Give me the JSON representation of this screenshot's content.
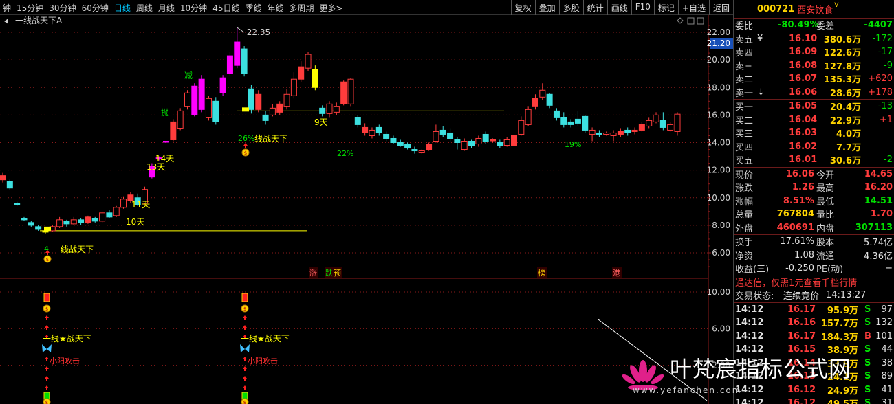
{
  "toolbar": {
    "periods": [
      "钟",
      "15分钟",
      "30分钟",
      "60分钟",
      "日线",
      "周线",
      "月线",
      "10分钟",
      "45日线",
      "季线",
      "年线",
      "多周期",
      "更多>"
    ],
    "active_period": "日线",
    "tools": [
      "复权",
      "叠加",
      "多股",
      "统计",
      "画线",
      "F10",
      "标记",
      "+自选",
      "返回"
    ]
  },
  "chart": {
    "indicator_title": "一线战天下A",
    "price_axis": [
      "22.00",
      "20.00",
      "18.00",
      "16.00",
      "14.00",
      "12.00",
      "10.00",
      "8.00",
      "6.00"
    ],
    "current_price_tag": "21.20",
    "sub_axis": [
      "10.00",
      "6.00",
      "2.00"
    ],
    "high_label": "22.35",
    "annotations": {
      "jian": "减",
      "pao": "抛",
      "t14": "14天",
      "t13": "13天",
      "t11": "11天",
      "t10": "10天",
      "t9": "9天",
      "pct26": "26%",
      "pct22": "22%",
      "pct19": "19%",
      "pct4": "4",
      "yxztx1": "一线战天下",
      "yxztx2": "线战天下"
    },
    "markers": {
      "zhang": "涨",
      "die": "跌",
      "yu": "预",
      "bang": "榜",
      "gang": "港"
    },
    "sub_labels": {
      "star1": "一线★战天下",
      "star2": "一线★战天下",
      "attack1": "小阳攻击",
      "attack2": "小阳攻击"
    },
    "colors": {
      "up": "#ff3c3c",
      "down": "#3ce0e0",
      "magenta": "#ff00ff",
      "yellow": "#ffff00",
      "grid": "#8a1a1a"
    }
  },
  "chart_data": {
    "type": "candlestick",
    "ylim": [
      5,
      23
    ],
    "candles": [
      {
        "o": 11.3,
        "c": 11.6,
        "h": 11.8,
        "l": 11.1
      },
      {
        "o": 11.2,
        "c": 10.7,
        "h": 11.3,
        "l": 10.6
      },
      {
        "o": 9.6,
        "c": 9.5,
        "h": 9.7,
        "l": 9.4
      },
      {
        "o": 8.5,
        "c": 8.4,
        "h": 8.6,
        "l": 8.3
      },
      {
        "o": 8.2,
        "c": 8.0,
        "h": 8.3,
        "l": 7.9
      },
      {
        "o": 7.9,
        "c": 7.7,
        "h": 8.0,
        "l": 7.6
      },
      {
        "o": 7.5,
        "c": 7.6,
        "h": 7.8,
        "l": 7.4
      },
      {
        "o": 7.6,
        "c": 7.9,
        "h": 8.0,
        "l": 7.5
      },
      {
        "o": 7.9,
        "c": 8.4,
        "h": 8.6,
        "l": 7.8
      },
      {
        "o": 8.3,
        "c": 8.1,
        "h": 8.4,
        "l": 7.9
      },
      {
        "o": 8.1,
        "c": 8.4,
        "h": 8.6,
        "l": 8.0
      },
      {
        "o": 8.4,
        "c": 8.2,
        "h": 8.5,
        "l": 8.0
      },
      {
        "o": 8.2,
        "c": 8.6,
        "h": 8.7,
        "l": 8.1
      },
      {
        "o": 8.5,
        "c": 8.3,
        "h": 8.6,
        "l": 8.2
      },
      {
        "o": 8.3,
        "c": 8.9,
        "h": 9.0,
        "l": 8.2
      },
      {
        "o": 8.9,
        "c": 8.6,
        "h": 9.1,
        "l": 8.5
      },
      {
        "o": 8.7,
        "c": 9.3,
        "h": 9.4,
        "l": 8.6
      },
      {
        "o": 9.3,
        "c": 9.9,
        "h": 10.1,
        "l": 9.2
      },
      {
        "o": 9.8,
        "c": 10.2,
        "h": 10.4,
        "l": 9.6
      },
      {
        "o": 10.0,
        "c": 9.5,
        "h": 10.3,
        "l": 9.4
      },
      {
        "o": 9.6,
        "c": 10.6,
        "h": 10.8,
        "l": 9.5
      },
      {
        "o": 11.5,
        "c": 12.3,
        "h": 12.5,
        "l": 11.4
      },
      {
        "o": 12.8,
        "c": 12.9,
        "h": 13.0,
        "l": 12.7
      },
      {
        "o": 14.1,
        "c": 14.1,
        "h": 14.3,
        "l": 13.9
      },
      {
        "o": 14.2,
        "c": 15.5,
        "h": 15.7,
        "l": 14.1
      },
      {
        "o": 15.0,
        "c": 16.3,
        "h": 16.5,
        "l": 14.9
      },
      {
        "o": 16.6,
        "c": 17.6,
        "h": 17.8,
        "l": 16.4
      },
      {
        "o": 16.0,
        "c": 18.1,
        "h": 18.3,
        "l": 15.9
      },
      {
        "o": 18.6,
        "c": 16.4,
        "h": 18.9,
        "l": 16.2
      },
      {
        "o": 15.8,
        "c": 17.2,
        "h": 17.4,
        "l": 15.6
      },
      {
        "o": 17.0,
        "c": 15.5,
        "h": 17.3,
        "l": 15.3
      },
      {
        "o": 17.6,
        "c": 18.7,
        "h": 18.9,
        "l": 17.4
      },
      {
        "o": 19.0,
        "c": 20.3,
        "h": 20.6,
        "l": 18.8
      },
      {
        "o": 19.6,
        "c": 21.3,
        "h": 22.35,
        "l": 19.4
      },
      {
        "o": 20.8,
        "c": 19.0,
        "h": 21.0,
        "l": 18.8
      },
      {
        "o": 17.9,
        "c": 16.4,
        "h": 18.2,
        "l": 16.1
      },
      {
        "o": 16.4,
        "c": 17.5,
        "h": 17.8,
        "l": 16.2
      },
      {
        "o": 16.0,
        "c": 15.6,
        "h": 16.3,
        "l": 15.3
      },
      {
        "o": 16.0,
        "c": 16.5,
        "h": 16.8,
        "l": 15.9
      },
      {
        "o": 16.2,
        "c": 16.8,
        "h": 17.0,
        "l": 16.0
      },
      {
        "o": 16.6,
        "c": 17.5,
        "h": 17.9,
        "l": 16.4
      },
      {
        "o": 17.4,
        "c": 18.6,
        "h": 19.1,
        "l": 17.2
      },
      {
        "o": 18.6,
        "c": 19.5,
        "h": 19.9,
        "l": 18.4
      },
      {
        "o": 19.4,
        "c": 20.4,
        "h": 20.6,
        "l": 19.2
      },
      {
        "o": 19.3,
        "c": 18.0,
        "h": 19.6,
        "l": 17.8
      },
      {
        "o": 16.5,
        "c": 16.1,
        "h": 16.7,
        "l": 15.9
      },
      {
        "o": 16.1,
        "c": 16.8,
        "h": 17.0,
        "l": 15.8
      },
      {
        "o": 16.2,
        "c": 16.6,
        "h": 16.9,
        "l": 16.0
      },
      {
        "o": 16.8,
        "c": 18.4,
        "h": 18.5,
        "l": 16.7
      },
      {
        "o": 16.8,
        "c": 18.6,
        "h": 18.7,
        "l": 16.6
      },
      {
        "o": 15.8,
        "c": 15.3,
        "h": 16.0,
        "l": 15.1
      },
      {
        "o": 14.7,
        "c": 15.1,
        "h": 15.4,
        "l": 14.5
      },
      {
        "o": 14.5,
        "c": 14.9,
        "h": 15.1,
        "l": 14.3
      },
      {
        "o": 15.1,
        "c": 14.7,
        "h": 15.3,
        "l": 14.5
      },
      {
        "o": 14.6,
        "c": 14.3,
        "h": 14.8,
        "l": 14.1
      },
      {
        "o": 14.3,
        "c": 14.0,
        "h": 14.5,
        "l": 13.9
      },
      {
        "o": 14.0,
        "c": 13.8,
        "h": 14.2,
        "l": 13.7
      },
      {
        "o": 13.9,
        "c": 13.6,
        "h": 14.0,
        "l": 13.5
      },
      {
        "o": 13.5,
        "c": 13.4,
        "h": 13.7,
        "l": 13.2
      },
      {
        "o": 13.3,
        "c": 13.4,
        "h": 13.5,
        "l": 13.2
      },
      {
        "o": 13.5,
        "c": 13.9,
        "h": 14.0,
        "l": 13.4
      },
      {
        "o": 14.1,
        "c": 14.8,
        "h": 15.3,
        "l": 14.0
      },
      {
        "o": 14.9,
        "c": 14.6,
        "h": 15.2,
        "l": 14.4
      },
      {
        "o": 14.7,
        "c": 14.3,
        "h": 15.0,
        "l": 14.0
      },
      {
        "o": 14.2,
        "c": 14.0,
        "h": 14.4,
        "l": 13.5
      },
      {
        "o": 13.5,
        "c": 14.1,
        "h": 14.3,
        "l": 13.4
      },
      {
        "o": 14.1,
        "c": 13.8,
        "h": 14.2,
        "l": 13.6
      },
      {
        "o": 13.9,
        "c": 14.3,
        "h": 14.5,
        "l": 13.7
      },
      {
        "o": 14.6,
        "c": 14.1,
        "h": 14.8,
        "l": 13.9
      },
      {
        "o": 14.2,
        "c": 14.2,
        "h": 14.3,
        "l": 14.0
      },
      {
        "o": 14.0,
        "c": 13.8,
        "h": 14.2,
        "l": 13.6
      },
      {
        "o": 13.8,
        "c": 14.2,
        "h": 14.4,
        "l": 13.7
      },
      {
        "o": 13.8,
        "c": 14.5,
        "h": 14.7,
        "l": 13.7
      },
      {
        "o": 14.6,
        "c": 15.6,
        "h": 15.9,
        "l": 14.5
      },
      {
        "o": 15.3,
        "c": 16.4,
        "h": 16.6,
        "l": 15.2
      },
      {
        "o": 16.6,
        "c": 17.2,
        "h": 17.5,
        "l": 16.4
      },
      {
        "o": 17.3,
        "c": 17.8,
        "h": 18.3,
        "l": 17.1
      },
      {
        "o": 17.5,
        "c": 16.7,
        "h": 17.6,
        "l": 16.5
      },
      {
        "o": 16.3,
        "c": 15.8,
        "h": 16.5,
        "l": 15.6
      },
      {
        "o": 15.8,
        "c": 15.3,
        "h": 16.2,
        "l": 15.1
      },
      {
        "o": 15.5,
        "c": 15.3,
        "h": 15.7,
        "l": 15.1
      },
      {
        "o": 15.7,
        "c": 15.4,
        "h": 16.3,
        "l": 15.2
      },
      {
        "o": 15.9,
        "c": 14.9,
        "h": 16.0,
        "l": 14.7
      },
      {
        "o": 14.6,
        "c": 14.9,
        "h": 15.1,
        "l": 14.1
      },
      {
        "o": 14.7,
        "c": 14.6,
        "h": 14.9,
        "l": 14.4
      },
      {
        "o": 14.6,
        "c": 14.7,
        "h": 14.8,
        "l": 14.5
      },
      {
        "o": 14.5,
        "c": 14.7,
        "h": 14.9,
        "l": 14.1
      },
      {
        "o": 14.6,
        "c": 14.8,
        "h": 15.0,
        "l": 14.4
      },
      {
        "o": 14.9,
        "c": 14.7,
        "h": 15.1,
        "l": 14.5
      },
      {
        "o": 14.8,
        "c": 14.9,
        "h": 15.1,
        "l": 14.6
      },
      {
        "o": 14.9,
        "c": 15.3,
        "h": 15.5,
        "l": 14.8
      },
      {
        "o": 15.2,
        "c": 15.6,
        "h": 15.8,
        "l": 15.0
      },
      {
        "o": 15.5,
        "c": 16.0,
        "h": 16.2,
        "l": 15.4
      },
      {
        "o": 15.6,
        "c": 15.1,
        "h": 16.2,
        "l": 14.9
      },
      {
        "o": 14.9,
        "c": 15.3,
        "h": 15.5,
        "l": 14.8
      },
      {
        "o": 14.8,
        "c": 16.06,
        "h": 16.2,
        "l": 14.5
      }
    ],
    "sub_series": {
      "group1_x": 68,
      "group2_x": 356
    }
  },
  "panel": {
    "code": "000721",
    "name": "西安饮食",
    "sup": "V",
    "weibi_label": "委比",
    "weibi": "-80.49%",
    "weicha_label": "委差",
    "weicha": "-4407",
    "sell": [
      {
        "label": "卖五",
        "flag": "¥",
        "price": "16.10",
        "vol": "380.6万",
        "chg": "-172"
      },
      {
        "label": "卖四",
        "flag": "",
        "price": "16.09",
        "vol": "122.6万",
        "chg": "-17"
      },
      {
        "label": "卖三",
        "flag": "",
        "price": "16.08",
        "vol": "127.8万",
        "chg": "-9"
      },
      {
        "label": "卖二",
        "flag": "",
        "price": "16.07",
        "vol": "135.3万",
        "chg": "+620"
      },
      {
        "label": "卖一",
        "flag": "↓",
        "price": "16.06",
        "vol": "28.6万",
        "chg": "+178"
      }
    ],
    "buy": [
      {
        "label": "买一",
        "price": "16.05",
        "vol": "20.4万",
        "chg": "-13"
      },
      {
        "label": "买二",
        "price": "16.04",
        "vol": "22.9万",
        "chg": "+1"
      },
      {
        "label": "买三",
        "price": "16.03",
        "vol": "4.0万",
        "chg": ""
      },
      {
        "label": "买四",
        "price": "16.02",
        "vol": "7.7万",
        "chg": ""
      },
      {
        "label": "买五",
        "price": "16.01",
        "vol": "30.6万",
        "chg": "-2"
      }
    ],
    "quote": [
      {
        "l1": "现价",
        "v1": "16.06",
        "l2": "今开",
        "v2": "14.65"
      },
      {
        "l1": "涨跌",
        "v1": "1.26",
        "l2": "最高",
        "v2": "16.20"
      },
      {
        "l1": "涨幅",
        "v1": "8.51%",
        "l2": "最低",
        "v2": "14.51"
      },
      {
        "l1": "总量",
        "v1": "767804",
        "l2": "量比",
        "v2": "1.70"
      },
      {
        "l1": "外盘",
        "v1": "460691",
        "l2": "内盘",
        "v2": "307113"
      }
    ],
    "info": [
      {
        "l1": "换手",
        "v1": "17.61%",
        "l2": "股本",
        "v2": "5.74亿"
      },
      {
        "l1": "净资",
        "v1": "1.08",
        "l2": "流通",
        "v2": "4.36亿"
      },
      {
        "l1": "收益(三)",
        "v1": "-0.250",
        "l2": "PE(动)",
        "v2": "−"
      }
    ],
    "ad": "通达信，仅需1元查看千档行情",
    "status_label": "交易状态:",
    "status": "连续竞价",
    "time": "14:13:27",
    "ticks": [
      {
        "t": "14:12",
        "p": "16.17",
        "v": "95.9万",
        "s": "S",
        "n": "97"
      },
      {
        "t": "14:12",
        "p": "16.16",
        "v": "157.7万",
        "s": "S",
        "n": "132"
      },
      {
        "t": "14:12",
        "p": "16.17",
        "v": "184.3万",
        "s": "B",
        "n": "101"
      },
      {
        "t": "14:12",
        "p": "16.15",
        "v": "38.9万",
        "s": "S",
        "n": "44"
      },
      {
        "t": "14:12",
        "p": "16.14",
        "v": "33.9万",
        "s": "S",
        "n": "38"
      },
      {
        "t": "14:12",
        "p": "16.13",
        "v": "24.1万",
        "s": "S",
        "n": "89"
      },
      {
        "t": "14:12",
        "p": "16.12",
        "v": "24.9万",
        "s": "S",
        "n": "41"
      },
      {
        "t": "14:12",
        "p": "16.12",
        "v": "49.5万",
        "s": "S",
        "n": "31"
      }
    ]
  },
  "watermark": {
    "text": "叶梵宸指标公式网",
    "url": "www.yefanchen.com"
  }
}
